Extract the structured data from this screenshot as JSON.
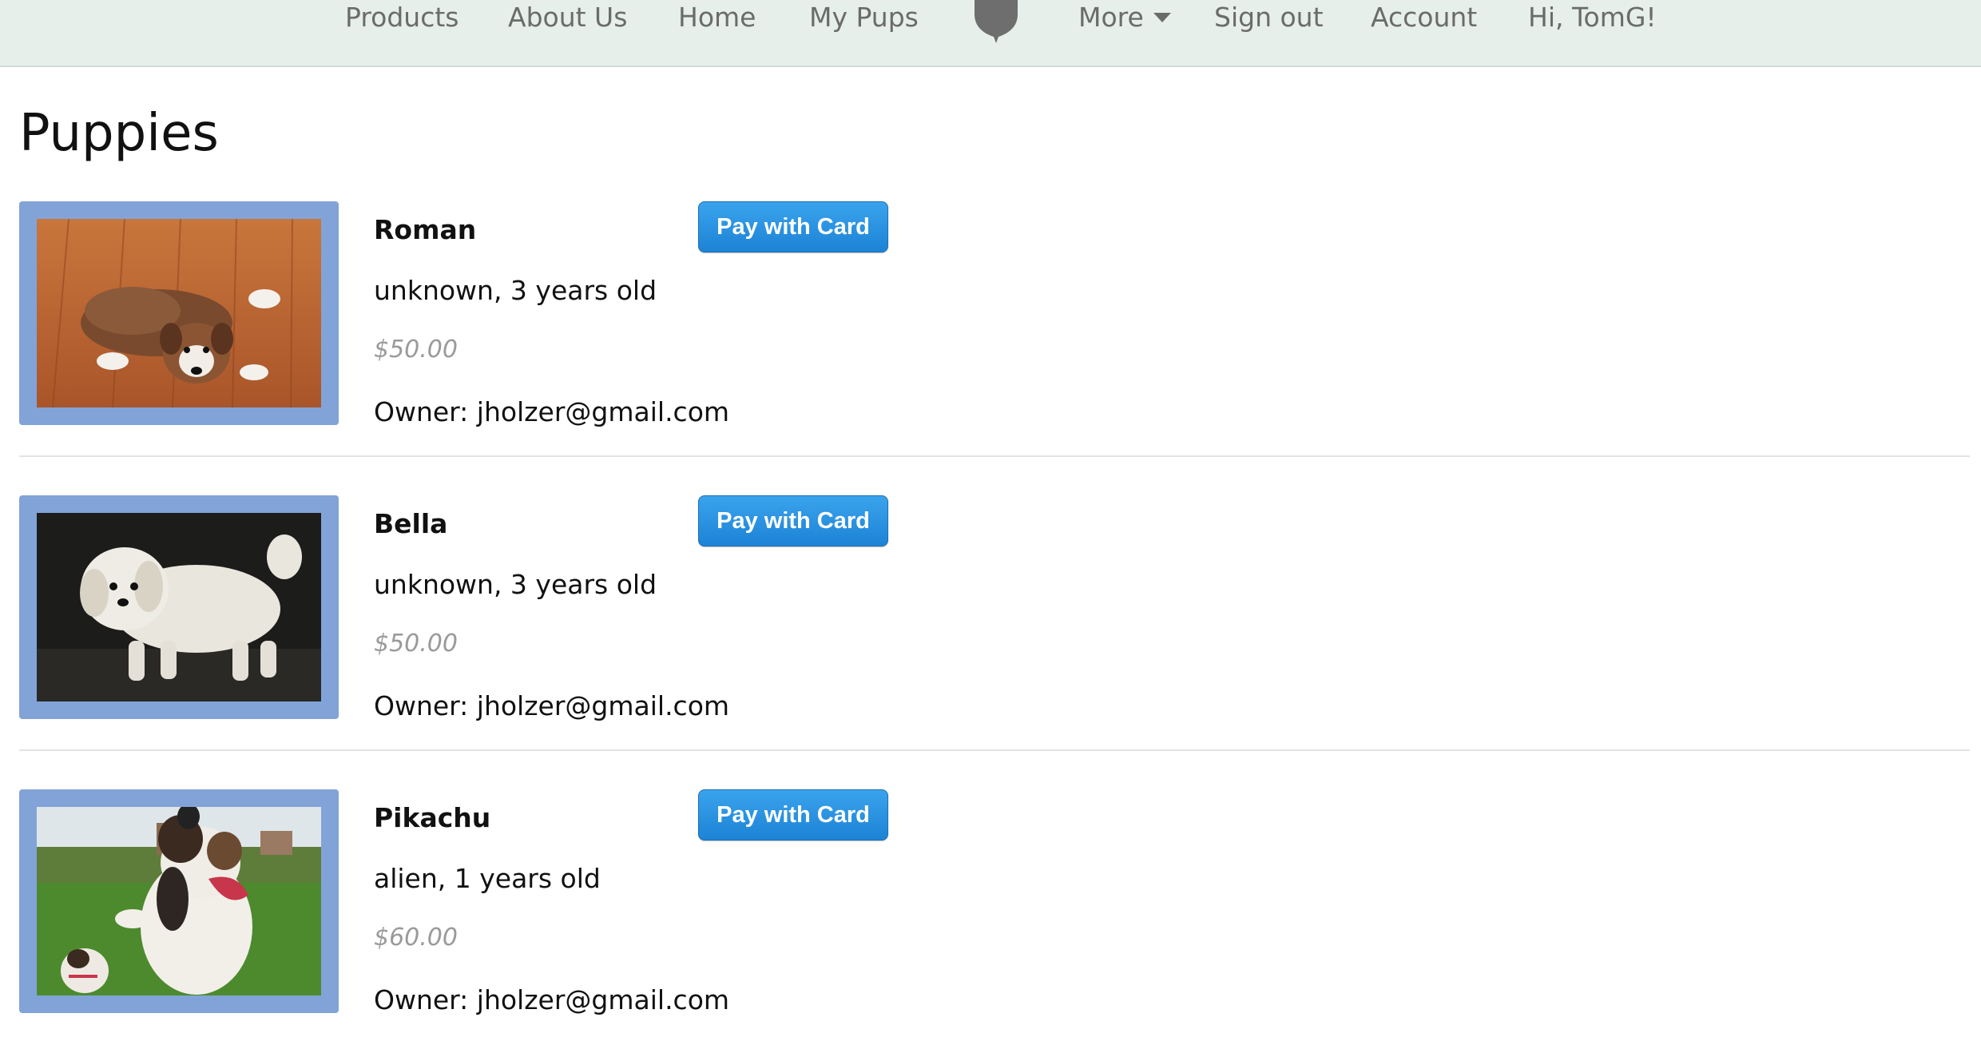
{
  "nav": {
    "items": [
      "Products",
      "About Us",
      "Home",
      "My Pups",
      "More",
      "Sign out",
      "Account",
      "Hi, TomG!"
    ]
  },
  "page": {
    "title": "Puppies"
  },
  "pups": [
    {
      "name": "Roman",
      "breed_age": "unknown, 3 years old",
      "price": "$50.00",
      "owner": "Owner: jholzer@gmail.com",
      "pay_label": "Pay with Card"
    },
    {
      "name": "Bella",
      "breed_age": "unknown, 3 years old",
      "price": "$50.00",
      "owner": "Owner: jholzer@gmail.com",
      "pay_label": "Pay with Card"
    },
    {
      "name": "Pikachu",
      "breed_age": "alien, 1 years old",
      "price": "$60.00",
      "owner": "Owner: jholzer@gmail.com",
      "pay_label": "Pay with Card"
    }
  ],
  "colors": {
    "navbar_bg": "#e6efe9",
    "nav_text": "#6b6b6b",
    "photo_frame": "#82a3d8",
    "pay_button": "#1d83d6",
    "price_text": "#9a9a9a"
  },
  "icons": {
    "logo": "shield-logo-icon",
    "more_caret": "caret-down-icon"
  }
}
